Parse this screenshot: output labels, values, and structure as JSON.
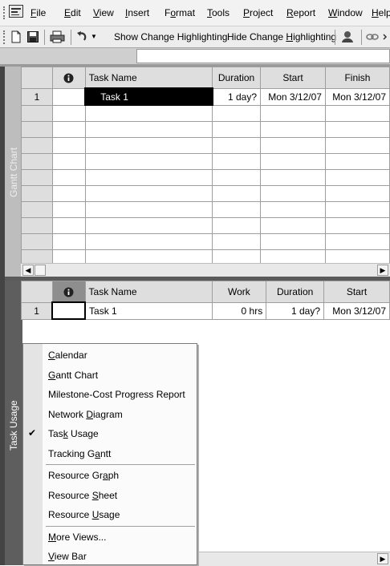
{
  "menubar": {
    "items": [
      {
        "pre": "",
        "u": "F",
        "post": "ile"
      },
      {
        "pre": "",
        "u": "E",
        "post": "dit"
      },
      {
        "pre": "",
        "u": "V",
        "post": "iew"
      },
      {
        "pre": "",
        "u": "I",
        "post": "nsert"
      },
      {
        "pre": "F",
        "u": "o",
        "post": "rmat"
      },
      {
        "pre": "",
        "u": "T",
        "post": "ools"
      },
      {
        "pre": "",
        "u": "P",
        "post": "roject"
      },
      {
        "pre": "",
        "u": "R",
        "post": "eport"
      },
      {
        "pre": "",
        "u": "W",
        "post": "indow"
      },
      {
        "pre": "",
        "u": "H",
        "post": "elp"
      }
    ]
  },
  "toolbar": {
    "show_change": "Show Change Highlighting",
    "hide_change_pre": "Hide Change ",
    "hide_change_u": "H",
    "hide_change_post": "ighlighting"
  },
  "gantt_pane": {
    "side_label": "Gantt Chart",
    "columns": [
      "Task Name",
      "Duration",
      "Start",
      "Finish"
    ],
    "rows": [
      {
        "id": "1",
        "name": "Task 1",
        "duration": "1 day?",
        "start": "Mon 3/12/07",
        "finish": "Mon 3/12/07"
      }
    ]
  },
  "usage_pane": {
    "side_label": "Task Usage",
    "columns": [
      "Task Name",
      "Work",
      "Duration",
      "Start"
    ],
    "rows": [
      {
        "id": "1",
        "name": "Task 1",
        "work": "0 hrs",
        "duration": "1 day?",
        "start": "Mon 3/12/07"
      }
    ]
  },
  "context_menu": {
    "groups": [
      [
        {
          "pre": "",
          "u": "C",
          "post": "alendar",
          "checked": false
        },
        {
          "pre": "",
          "u": "G",
          "post": "antt Chart",
          "checked": false
        },
        {
          "pre": "Milestone-Cost Progress Report",
          "u": "",
          "post": "",
          "checked": false
        },
        {
          "pre": "Network ",
          "u": "D",
          "post": "iagram",
          "checked": false
        },
        {
          "pre": "Tas",
          "u": "k",
          "post": " Usage",
          "checked": true
        },
        {
          "pre": "Tracking G",
          "u": "a",
          "post": "ntt",
          "checked": false
        }
      ],
      [
        {
          "pre": "Resource Gr",
          "u": "a",
          "post": "ph",
          "checked": false
        },
        {
          "pre": "Resource ",
          "u": "S",
          "post": "heet",
          "checked": false
        },
        {
          "pre": "Resource ",
          "u": "U",
          "post": "sage",
          "checked": false
        }
      ],
      [
        {
          "pre": "",
          "u": "M",
          "post": "ore Views...",
          "checked": false
        },
        {
          "pre": "",
          "u": "V",
          "post": "iew Bar",
          "checked": false
        }
      ]
    ]
  },
  "icons": {
    "app": "project-app-icon",
    "new": "new-document-icon",
    "save": "save-icon",
    "print": "print-icon",
    "undo": "undo-icon",
    "info_column": "info-column-icon",
    "check": "checkmark-icon"
  }
}
